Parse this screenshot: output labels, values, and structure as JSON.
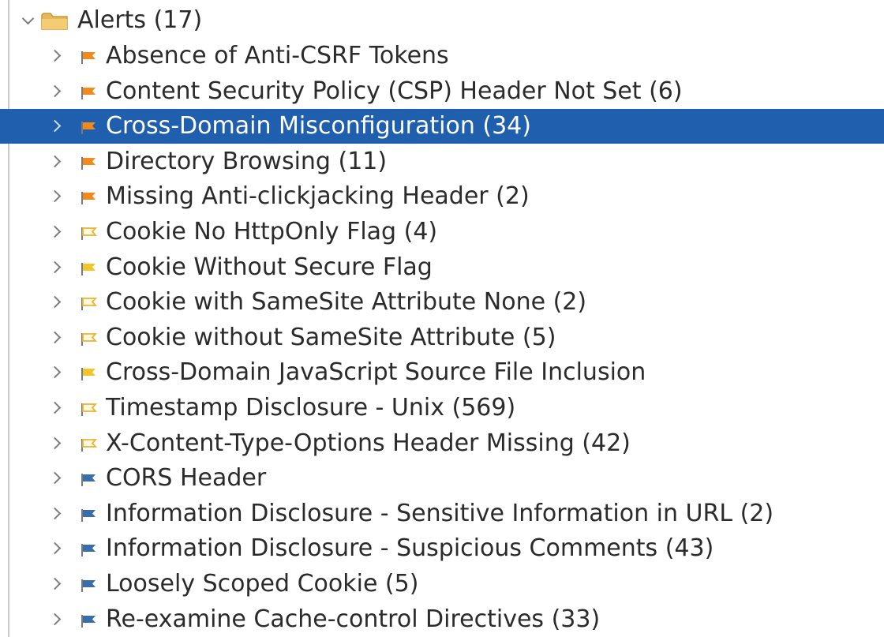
{
  "root": {
    "label": "Alerts (17)",
    "expanded": true,
    "icon": "folder-icon"
  },
  "colors": {
    "selection": "#1f5fae",
    "risk_high": "#f08a1c",
    "risk_medium": "#f2c62b",
    "risk_low_outline": "#e9b530",
    "risk_info": "#3a6ea8"
  },
  "alerts": [
    {
      "label": "Absence of Anti-CSRF Tokens",
      "flag": "solid-orange-flag-icon",
      "selected": false
    },
    {
      "label": "Content Security Policy (CSP) Header Not Set (6)",
      "flag": "solid-orange-flag-icon",
      "selected": false
    },
    {
      "label": "Cross-Domain Misconfiguration (34)",
      "flag": "solid-orange-flag-icon",
      "selected": true
    },
    {
      "label": "Directory Browsing (11)",
      "flag": "solid-orange-flag-icon",
      "selected": false
    },
    {
      "label": "Missing Anti-clickjacking Header (2)",
      "flag": "solid-orange-flag-icon",
      "selected": false
    },
    {
      "label": "Cookie No HttpOnly Flag (4)",
      "flag": "outline-yellow-flag-icon",
      "selected": false
    },
    {
      "label": "Cookie Without Secure Flag",
      "flag": "solid-yellow-flag-icon",
      "selected": false
    },
    {
      "label": "Cookie with SameSite Attribute None (2)",
      "flag": "outline-yellow-flag-icon",
      "selected": false
    },
    {
      "label": "Cookie without SameSite Attribute (5)",
      "flag": "outline-yellow-flag-icon",
      "selected": false
    },
    {
      "label": "Cross-Domain JavaScript Source File Inclusion",
      "flag": "solid-yellow-flag-icon",
      "selected": false
    },
    {
      "label": "Timestamp Disclosure - Unix (569)",
      "flag": "outline-yellow-flag-icon",
      "selected": false
    },
    {
      "label": "X-Content-Type-Options Header Missing (42)",
      "flag": "outline-yellow-flag-icon",
      "selected": false
    },
    {
      "label": "CORS Header",
      "flag": "blue-flag-icon",
      "selected": false
    },
    {
      "label": "Information Disclosure - Sensitive Information in URL (2)",
      "flag": "blue-flag-icon",
      "selected": false
    },
    {
      "label": "Information Disclosure - Suspicious Comments (43)",
      "flag": "blue-flag-icon",
      "selected": false
    },
    {
      "label": "Loosely Scoped Cookie (5)",
      "flag": "blue-flag-icon",
      "selected": false
    },
    {
      "label": "Re-examine Cache-control Directives (33)",
      "flag": "blue-flag-icon",
      "selected": false
    }
  ]
}
